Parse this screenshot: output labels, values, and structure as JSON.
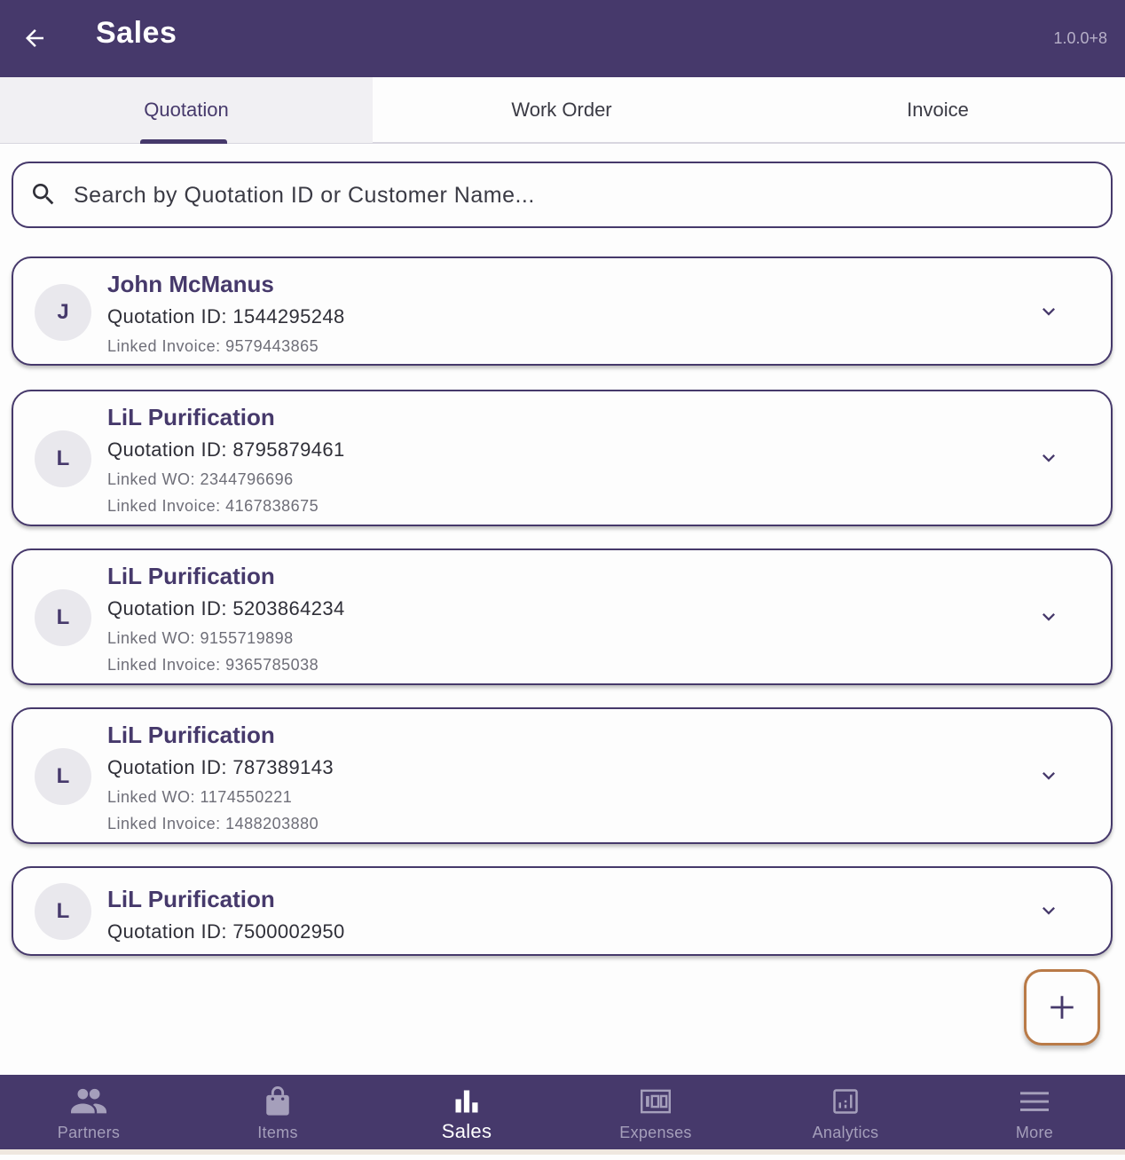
{
  "appbar": {
    "title": "Sales",
    "version": "1.0.0+8"
  },
  "tabs": [
    {
      "label": "Quotation",
      "active": true
    },
    {
      "label": "Work Order",
      "active": false
    },
    {
      "label": "Invoice",
      "active": false
    }
  ],
  "search": {
    "placeholder": "Search by Quotation ID or Customer Name..."
  },
  "quotations": [
    {
      "initial": "J",
      "name": "John McManus",
      "quotation_id": "Quotation ID: 1544295248",
      "linked_invoice": "Linked Invoice: 9579443865"
    },
    {
      "initial": "L",
      "name": "LiL Purification",
      "quotation_id": "Quotation ID: 8795879461",
      "linked_wo": "Linked WO: 2344796696",
      "linked_invoice": "Linked Invoice: 4167838675"
    },
    {
      "initial": "L",
      "name": "LiL Purification",
      "quotation_id": "Quotation ID: 5203864234",
      "linked_wo": "Linked WO: 9155719898",
      "linked_invoice": "Linked Invoice: 9365785038"
    },
    {
      "initial": "L",
      "name": "LiL Purification",
      "quotation_id": "Quotation ID: 787389143",
      "linked_wo": "Linked WO: 1174550221",
      "linked_invoice": "Linked Invoice: 1488203880"
    },
    {
      "initial": "L",
      "name": "LiL Purification",
      "quotation_id": "Quotation ID: 7500002950"
    }
  ],
  "fab": {
    "icon": "plus-icon"
  },
  "bottom_nav": [
    {
      "label": "Partners",
      "icon": "people-icon",
      "active": false
    },
    {
      "label": "Items",
      "icon": "shopping-bag-icon",
      "active": false
    },
    {
      "label": "Sales",
      "icon": "bar-chart-icon",
      "active": true
    },
    {
      "label": "Expenses",
      "icon": "money-icon",
      "active": false
    },
    {
      "label": "Analytics",
      "icon": "analytics-icon",
      "active": false
    },
    {
      "label": "More",
      "icon": "menu-icon",
      "active": false
    }
  ],
  "colors": {
    "primary": "#46396b",
    "accent": "#b97a47",
    "inactive_nav": "#a59fbb"
  }
}
